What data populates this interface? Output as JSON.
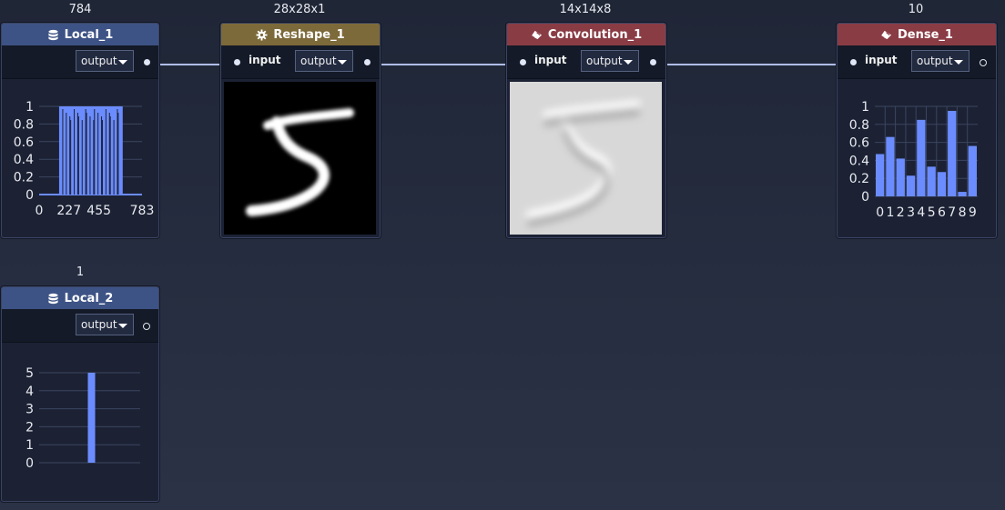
{
  "nodes": {
    "local1": {
      "title": "Local_1",
      "shape": "784",
      "output_label": "output",
      "chart_data": {
        "type": "bar",
        "title": "",
        "xlabel": "",
        "ylabel": "",
        "x_tick_labels": [
          "0",
          "227",
          "455",
          "783"
        ],
        "y_tick_labels": [
          "0",
          "0.2",
          "0.4",
          "0.6",
          "0.8",
          "1"
        ],
        "xlim": [
          0,
          783
        ],
        "ylim": [
          0,
          1
        ],
        "filled_range": [
          152,
          636
        ],
        "value_in_range": 1,
        "grid": true
      }
    },
    "reshape1": {
      "title": "Reshape_1",
      "shape": "28x28x1",
      "input_label": "input",
      "output_label": "output"
    },
    "conv1": {
      "title": "Convolution_1",
      "shape": "14x14x8",
      "input_label": "input",
      "output_label": "output"
    },
    "dense1": {
      "title": "Dense_1",
      "shape": "10",
      "input_label": "input",
      "output_label": "output",
      "chart_data": {
        "type": "bar",
        "title": "",
        "xlabel": "",
        "ylabel": "",
        "categories": [
          "0",
          "1",
          "2",
          "3",
          "4",
          "5",
          "6",
          "7",
          "8",
          "9"
        ],
        "values": [
          0.47,
          0.66,
          0.42,
          0.23,
          0.85,
          0.33,
          0.27,
          0.95,
          0.05,
          0.56
        ],
        "y_tick_labels": [
          "0",
          "0.2",
          "0.4",
          "0.6",
          "0.8",
          "1"
        ],
        "ylim": [
          0,
          1
        ],
        "grid": true
      }
    },
    "local2": {
      "title": "Local_2",
      "shape": "1",
      "output_label": "output",
      "chart_data": {
        "type": "bar",
        "title": "",
        "xlabel": "",
        "ylabel": "",
        "categories": [
          ""
        ],
        "values": [
          5
        ],
        "y_tick_labels": [
          "0",
          "1",
          "2",
          "3",
          "4",
          "5"
        ],
        "ylim": [
          0,
          5
        ],
        "grid": true
      }
    }
  },
  "colors": {
    "bar": "#6b8cff",
    "grid": "#3b4560",
    "header_local": "#3e5385",
    "header_reshape": "#7d6a3a",
    "header_layer": "#8a3c45"
  },
  "icons": {
    "local": "database-icon",
    "reshape": "gear-icon",
    "layer": "eraser-icon"
  }
}
